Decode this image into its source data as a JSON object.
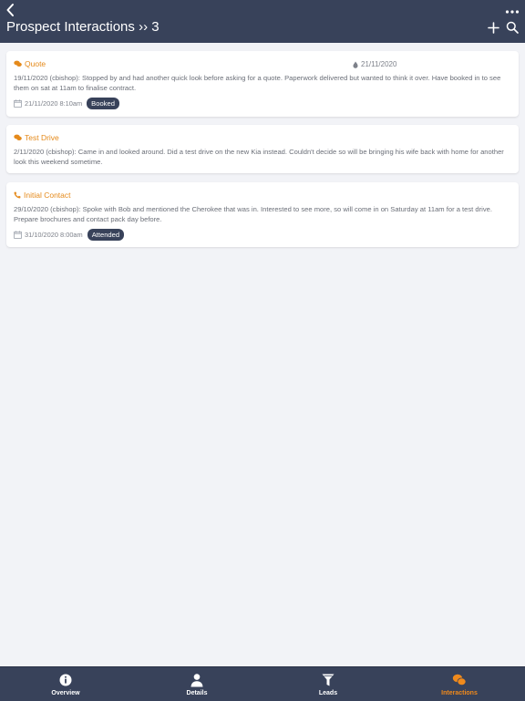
{
  "header": {
    "title": "Prospect Interactions ›› 3",
    "back_icon": "chevron-left-icon",
    "more_icon": "ellipsis-icon",
    "add_icon": "plus-icon",
    "search_icon": "search-icon"
  },
  "interactions": [
    {
      "type": "Quote",
      "type_icon": "chat-bubbles-icon",
      "right_date": "21/11/2020",
      "right_date_icon": "flame-icon",
      "text": "19/11/2020 (cbishop): Stopped by and had another quick look before asking for a quote. Paperwork delivered but wanted to think it over. Have booked in to see them on sat at 11am to finalise contract.",
      "appointment": "21/11/2020 8:10am",
      "status": "Booked"
    },
    {
      "type": "Test Drive",
      "type_icon": "chat-bubbles-icon",
      "text": "2/11/2020 (cbishop): Came in and looked around. Did a test drive on the new Kia instead. Couldn't decide so will be bringing his wife back with home for another look this weekend sometime."
    },
    {
      "type": "Initial Contact",
      "type_icon": "phone-icon",
      "text": "29/10/2020 (cbishop): Spoke with Bob and mentioned the Cherokee that was in. Interested to see more, so will come in on Saturday at 11am for a test drive. Prepare brochures and contact pack day before.",
      "appointment": "31/10/2020 8:00am",
      "status": "Attended"
    }
  ],
  "tabs": [
    {
      "label": "Overview",
      "icon": "info-icon"
    },
    {
      "label": "Details",
      "icon": "person-icon"
    },
    {
      "label": "Leads",
      "icon": "funnel-icon"
    },
    {
      "label": "Interactions",
      "icon": "chat-bubbles-icon",
      "active": true
    }
  ],
  "colors": {
    "header_bg": "#38425a",
    "accent": "#e58a1b",
    "page_bg": "#f2f3f7",
    "badge_bg": "#38425a"
  }
}
